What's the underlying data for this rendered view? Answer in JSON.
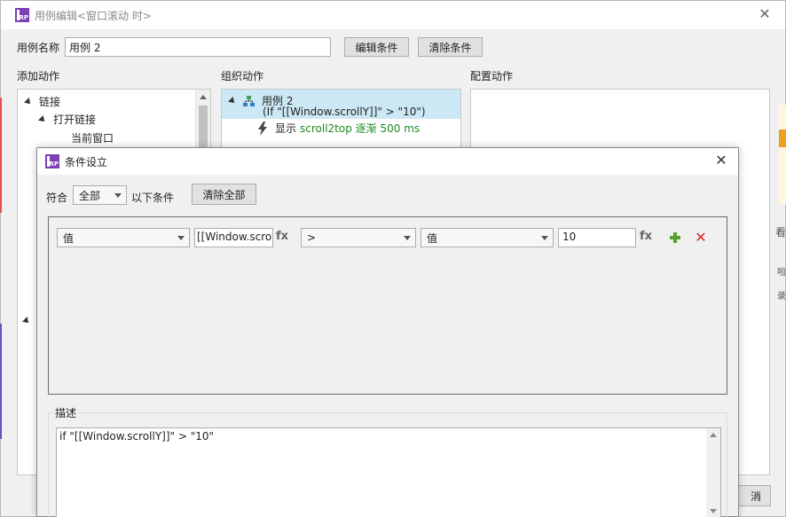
{
  "outer_window": {
    "title": "用例编辑<窗口滚动 时>",
    "case_name_label": "用例名称",
    "case_name_value": "用例 2",
    "edit_condition_button": "编辑条件",
    "clear_condition_button": "清除条件",
    "add_action_label": "添加动作",
    "organize_action_label": "组织动作",
    "configure_action_label": "配置动作",
    "cancel_button": "消"
  },
  "add_action_tree": [
    {
      "label": "链接",
      "expanded": true
    },
    {
      "label": "打开链接",
      "expanded": true
    },
    {
      "label": "当前窗口"
    }
  ],
  "organize_tree": {
    "case_title": "用例 2",
    "case_condition": "(If \"[[Window.scrollY]]\" > \"10\")",
    "action_prefix": "显示",
    "action_detail": "scroll2top 逐渐 500 ms"
  },
  "right_edge_fragments": [
    "看",
    "啦",
    "录"
  ],
  "condition_dialog": {
    "title": "条件设立",
    "match_label": "符合",
    "match_value": "全部",
    "following_conditions_label": "以下条件",
    "clear_all_button": "清除全部",
    "condition_row": {
      "left_type": "值",
      "left_value": "[[Window.scrollY",
      "fx_label": "fx",
      "operator": ">",
      "right_type": "值",
      "right_value": "10"
    },
    "description_label": "描述",
    "description_text": "if \"[[Window.scrollY]]\" > \"10\""
  },
  "colors": {
    "logo_purple": "#7b3fb8",
    "selection_blue": "#cce8f4",
    "action_green": "#1e8a1e",
    "add_green": "#5aa02c",
    "delete_red": "#e0261f"
  },
  "icons": [
    "rp-logo-icon",
    "close-icon",
    "case-tree-icon",
    "lightning-icon",
    "plus-icon",
    "delete-icon",
    "fx-icon",
    "dropdown-arrow-icon"
  ]
}
